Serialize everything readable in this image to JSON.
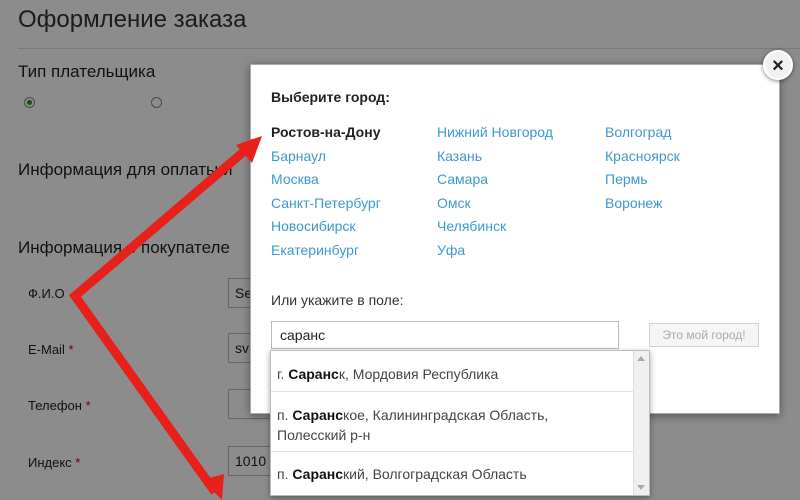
{
  "page": {
    "title": "Оформление заказа",
    "payer_type_heading": "Тип плательщика",
    "payment_info_heading_partial": "Информация для оплаты и",
    "buyer_info_heading_partial": "Информация о покупателе",
    "fields": [
      {
        "label": "Ф.И.О",
        "required": "",
        "value": "Se"
      },
      {
        "label": "E-Mail",
        "required": "*",
        "value": "sv"
      },
      {
        "label": "Телефон",
        "required": "*",
        "value": ""
      },
      {
        "label": "Индекс",
        "required": "*",
        "value": "1010"
      }
    ]
  },
  "modal": {
    "heading": "Выберите город:",
    "close_symbol": "×",
    "cities_col1": [
      "Ростов-на-Дону",
      "Барнаул",
      "Москва",
      "Санкт-Петербург",
      "Новосибирск",
      "Екатеринбург"
    ],
    "cities_col2": [
      "Нижний Новгород",
      "Казань",
      "Самара",
      "Омск",
      "Челябинск",
      "Уфа"
    ],
    "cities_col3": [
      "Волгоград",
      "Красноярск",
      "Пермь",
      "Воронеж"
    ],
    "current_city": "Ростов-на-Дону",
    "or_label": "Или укажите в поле:",
    "input_value": "саранс",
    "my_city_button": "Это мой город!"
  },
  "dropdown": {
    "items": [
      {
        "prefix": "г. ",
        "match": "Саранс",
        "rest": "к, Мордовия Республика"
      },
      {
        "prefix": "п. ",
        "match": "Саранс",
        "rest": "кое, Калининградская Область,",
        "line2": "Полесский р-н"
      },
      {
        "prefix": "п. ",
        "match": "Саранс",
        "rest": "кий, Волгоградская Область"
      }
    ]
  },
  "colors": {
    "city_link": "#3a9ad0",
    "required_star": "#dd0000",
    "arrow": "#e8201c"
  }
}
